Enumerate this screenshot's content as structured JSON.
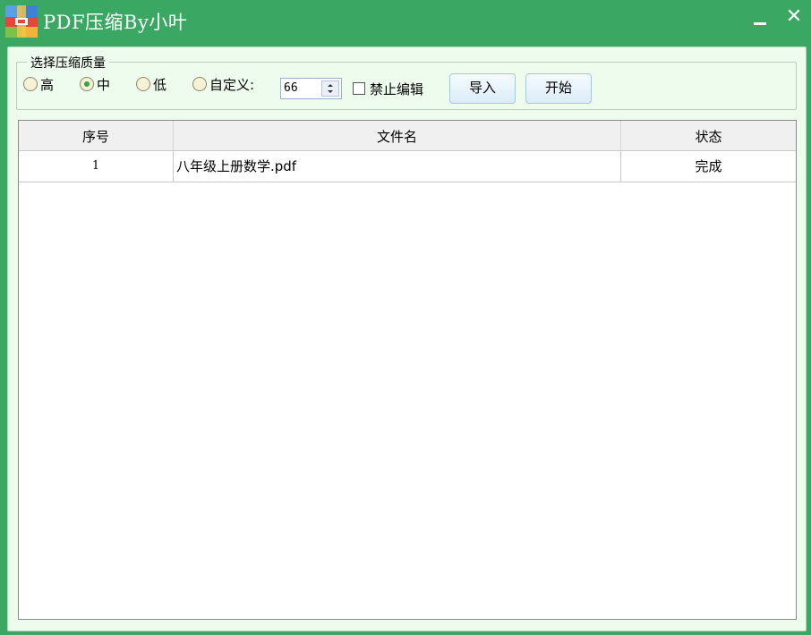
{
  "window": {
    "title": "PDF压缩By小叶",
    "icon": "app-icon",
    "accent_color": "#3aa862"
  },
  "controls": {
    "group_label": "选择压缩质量",
    "quality_options": [
      {
        "label": "高",
        "selected": false
      },
      {
        "label": "中",
        "selected": true
      },
      {
        "label": "低",
        "selected": false
      },
      {
        "label": "自定义:",
        "selected": false
      }
    ],
    "custom_value": "66",
    "disable_edit_label": "禁止编辑",
    "disable_edit_checked": false,
    "import_label": "导入",
    "start_label": "开始"
  },
  "table": {
    "columns": [
      "序号",
      "文件名",
      "状态"
    ],
    "rows": [
      {
        "index": "1",
        "filename": "八年级上册数学.pdf",
        "status": "完成"
      }
    ]
  }
}
